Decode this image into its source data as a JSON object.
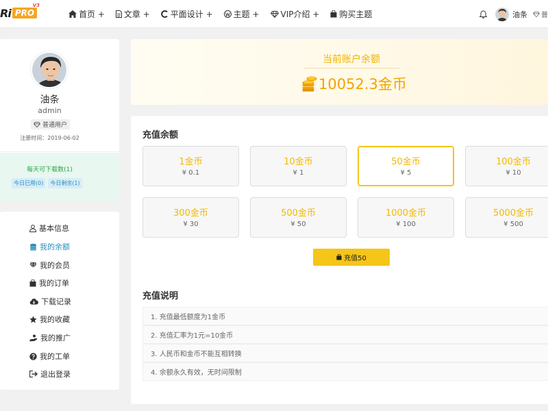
{
  "header": {
    "logo_text": "Ri",
    "logo_badge": "PRO",
    "logo_version": "V3",
    "nav": [
      {
        "label": "首页 +",
        "icon": "home-icon"
      },
      {
        "label": "文章 +",
        "icon": "document-icon"
      },
      {
        "label": "平面设计 +",
        "icon": "circle-arc-icon"
      },
      {
        "label": "主题 +",
        "icon": "wordpress-icon"
      },
      {
        "label": "VIP介绍 +",
        "icon": "diamond-icon"
      },
      {
        "label": "购买主题",
        "icon": "shopping-bag-icon"
      }
    ],
    "user_name": "油条",
    "vip_label": "普"
  },
  "profile": {
    "name": "油条",
    "username": "admin",
    "badge": "普通用户",
    "registered": "注册时间：2019-06-02",
    "downloads_per_day": "每天可下载数(1)",
    "used_today": "今日已用(0)",
    "remaining_today": "今日剩余(1)"
  },
  "menu": [
    {
      "label": "基本信息",
      "icon": "user-icon",
      "active": false
    },
    {
      "label": "我的余额",
      "icon": "coins-icon",
      "active": true
    },
    {
      "label": "我的会员",
      "icon": "diamond-icon",
      "active": false
    },
    {
      "label": "我的订单",
      "icon": "shopping-bag-icon",
      "active": false
    },
    {
      "label": "下载记录",
      "icon": "cloud-download-icon",
      "active": false
    },
    {
      "label": "我的收藏",
      "icon": "star-icon",
      "active": false
    },
    {
      "label": "我的推广",
      "icon": "hand-coin-icon",
      "active": false
    },
    {
      "label": "我的工单",
      "icon": "question-circle-icon",
      "active": false
    },
    {
      "label": "退出登录",
      "icon": "sign-out-icon",
      "active": false
    }
  ],
  "balance": {
    "label": "当前账户余额",
    "value": "10052.3金币"
  },
  "recharge": {
    "title": "充值余额",
    "options": [
      {
        "name": "1金币",
        "price": "¥ 0.1",
        "selected": false
      },
      {
        "name": "10金币",
        "price": "¥ 1",
        "selected": false
      },
      {
        "name": "50金币",
        "price": "¥ 5",
        "selected": true
      },
      {
        "name": "100金币",
        "price": "¥ 10",
        "selected": false
      },
      {
        "name": "300金币",
        "price": "¥ 30",
        "selected": false
      },
      {
        "name": "500金币",
        "price": "¥ 50",
        "selected": false
      },
      {
        "name": "1000金币",
        "price": "¥ 100",
        "selected": false
      },
      {
        "name": "5000金币",
        "price": "¥ 500",
        "selected": false
      }
    ],
    "pay_button": "充值50",
    "notes_title": "充值说明",
    "notes": [
      "1. 充值最低额度为1金币",
      "2. 充值汇率为1元=10金币",
      "3. 人民币和金币不能互相转换",
      "4. 余额永久有效，无时间限制"
    ]
  },
  "colors": {
    "accent": "#f5c518",
    "coin_text": "#f5b800",
    "link_active": "#2a8fbd",
    "success": "#28a745"
  }
}
